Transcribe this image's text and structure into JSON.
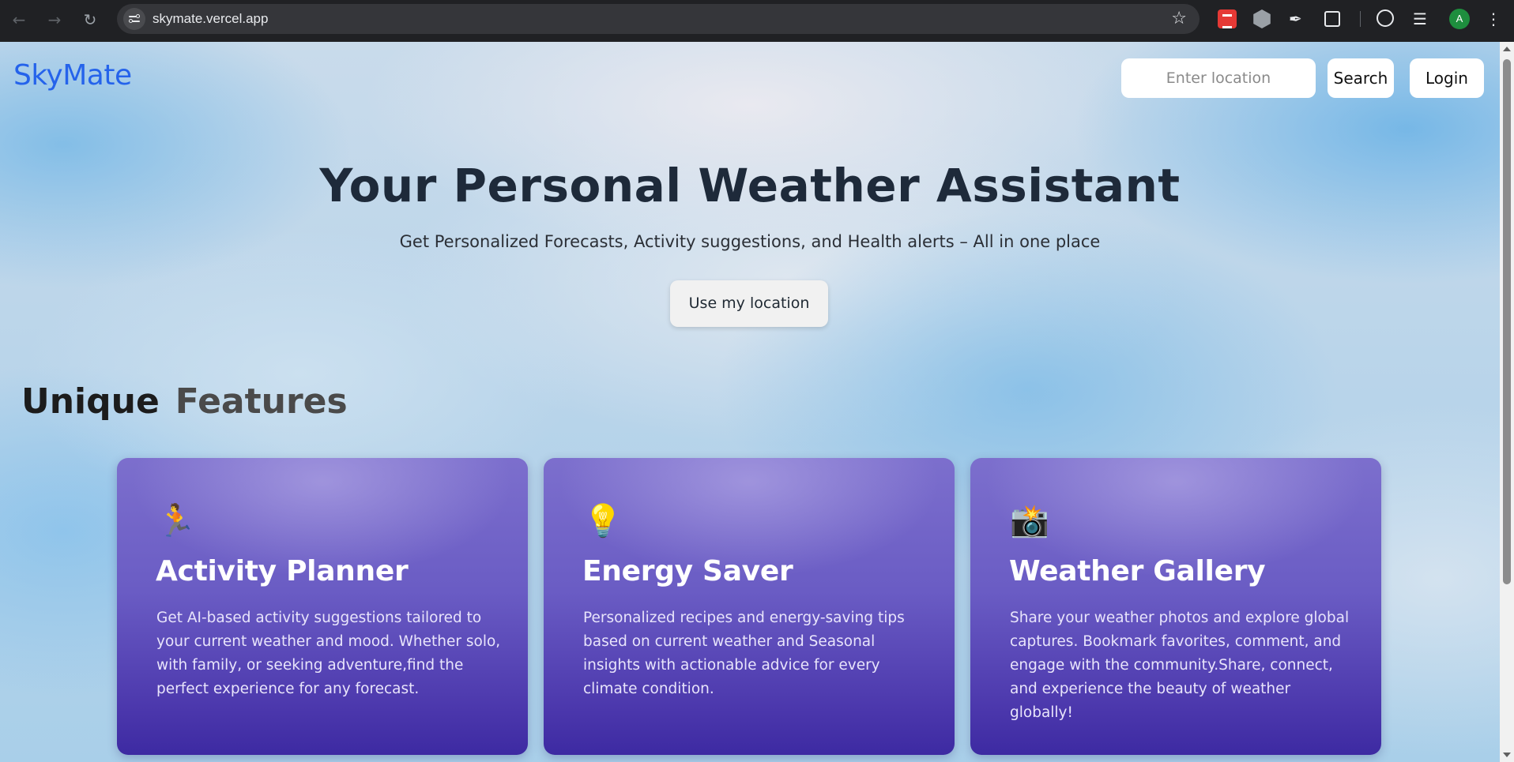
{
  "browser": {
    "url": "skymate.vercel.app",
    "profile_initial": "A",
    "icons": {
      "back": "arrow-left-icon",
      "forward": "arrow-right-icon",
      "reload": "reload-icon",
      "bookmark": "star-icon",
      "menu": "kebab-menu-icon"
    }
  },
  "header": {
    "logo": "SkyMate",
    "search_placeholder": "Enter location",
    "search_value": "",
    "search_label": "Search",
    "login_label": "Login",
    "brand_color": "#2563eb"
  },
  "hero": {
    "title": "Your Personal Weather Assistant",
    "subtitle": "Get Personalized Forecasts, Activity suggestions, and Health alerts – All in one place",
    "cta_label": "Use my location"
  },
  "features": {
    "title_word1": "Unique",
    "title_word2": "Features",
    "cards": [
      {
        "icon": "🏃",
        "icon_name": "running-person-icon",
        "title": "Activity Planner",
        "description": "Get AI-based activity suggestions tailored to your current weather and mood. Whether solo, with family, or seeking adventure,find the perfect experience for any forecast."
      },
      {
        "icon": "💡",
        "icon_name": "light-bulb-icon",
        "title": "Energy Saver",
        "description": "Personalized recipes and energy-saving tips based on current weather and Seasonal insights with actionable advice for every climate condition."
      },
      {
        "icon": "📸",
        "icon_name": "camera-flash-icon",
        "title": "Weather Gallery",
        "description": "Share your weather photos and explore global captures. Bookmark favorites, comment, and engage with the community.Share, connect, and experience the beauty of weather globally!"
      }
    ]
  }
}
